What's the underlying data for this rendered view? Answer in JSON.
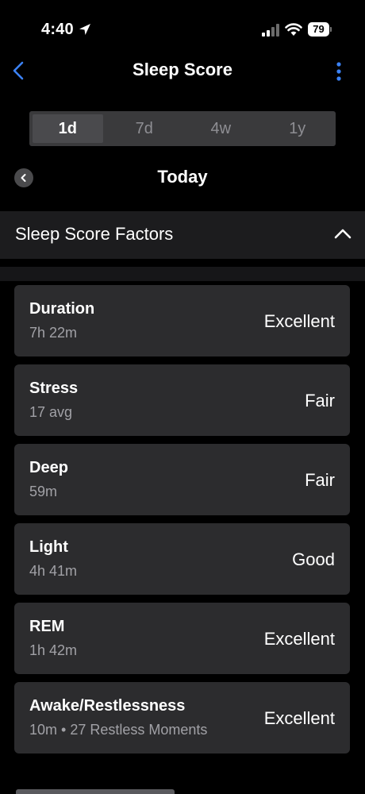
{
  "status_bar": {
    "time": "4:40",
    "battery_level": "79"
  },
  "header": {
    "title": "Sleep Score"
  },
  "range_tabs": [
    {
      "label": "1d",
      "active": true
    },
    {
      "label": "7d",
      "active": false
    },
    {
      "label": "4w",
      "active": false
    },
    {
      "label": "1y",
      "active": false
    }
  ],
  "date_nav": {
    "label": "Today"
  },
  "section": {
    "title": "Sleep Score Factors"
  },
  "factors": [
    {
      "name": "Duration",
      "detail": "7h 22m",
      "rating": "Excellent"
    },
    {
      "name": "Stress",
      "detail": "17 avg",
      "rating": "Fair"
    },
    {
      "name": "Deep",
      "detail": "59m",
      "rating": "Fair"
    },
    {
      "name": "Light",
      "detail": "4h 41m",
      "rating": "Good"
    },
    {
      "name": "REM",
      "detail": "1h 42m",
      "rating": "Excellent"
    },
    {
      "name": "Awake/Restlessness",
      "detail": "10m • 27 Restless Moments",
      "rating": "Excellent"
    }
  ],
  "colors": {
    "accent": "#3b82f6",
    "background": "#000000",
    "card": "#2c2c2e"
  }
}
